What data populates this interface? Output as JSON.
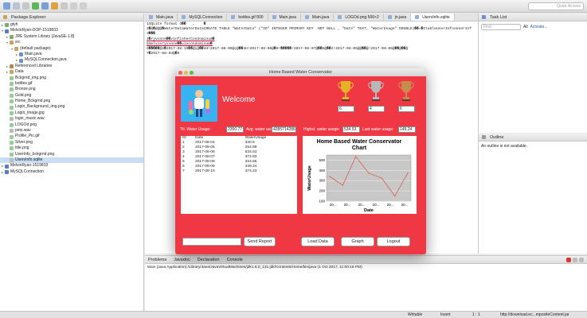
{
  "toolbar": {
    "quick_access": "Quick Access"
  },
  "package_explorer": {
    "title": "Package Explorer",
    "items": [
      {
        "label": "gtyh",
        "indent": 0,
        "twisty": "▸",
        "color": "#7a7"
      },
      {
        "label": "MelvinRyan-DOP-1519833",
        "indent": 0,
        "twisty": "▾",
        "color": "#5a7cc6"
      },
      {
        "label": "JRE System Library [JavaSE-1.8]",
        "indent": 1,
        "twisty": "▸",
        "color": "#8a6"
      },
      {
        "label": "src",
        "indent": 1,
        "twisty": "▾",
        "color": "#c9a45e"
      },
      {
        "label": "(default package)",
        "indent": 2,
        "twisty": "▾",
        "color": "#c9a45e"
      },
      {
        "label": "Main.java",
        "indent": 3,
        "twisty": "▸",
        "color": "#6b8fd0"
      },
      {
        "label": "MySQLConnection.java",
        "indent": 3,
        "twisty": "▸",
        "color": "#6b8fd0"
      },
      {
        "label": "Referenced Libraries",
        "indent": 1,
        "twisty": "▸",
        "color": "#b08850"
      },
      {
        "label": "Data",
        "indent": 1,
        "twisty": "▸",
        "color": "#c9a45e"
      },
      {
        "label": "Bckgrnd_img.png",
        "indent": 1,
        "twisty": "",
        "color": "#9c9"
      },
      {
        "label": "bottles.gif",
        "indent": 1,
        "twisty": "",
        "color": "#9c9"
      },
      {
        "label": "Bronze.png",
        "indent": 1,
        "twisty": "",
        "color": "#9c9"
      },
      {
        "label": "Gold.png",
        "indent": 1,
        "twisty": "",
        "color": "#9c9"
      },
      {
        "label": "Home_Bckgrnd.png",
        "indent": 1,
        "twisty": "",
        "color": "#9c9"
      },
      {
        "label": "Login_Background_img.png",
        "indent": 1,
        "twisty": "",
        "color": "#9c9"
      },
      {
        "label": "Login_image.jpg",
        "indent": 1,
        "twisty": "",
        "color": "#9c9"
      },
      {
        "label": "login_music.wav",
        "indent": 1,
        "twisty": "",
        "color": "#bbb"
      },
      {
        "label": "LOGOd.png",
        "indent": 1,
        "twisty": "",
        "color": "#9c9"
      },
      {
        "label": "pets.wav",
        "indent": 1,
        "twisty": "",
        "color": "#bbb"
      },
      {
        "label": "Profile_Pic.gif",
        "indent": 1,
        "twisty": "",
        "color": "#9c9"
      },
      {
        "label": "Silver.png",
        "indent": 1,
        "twisty": "",
        "color": "#9c9"
      },
      {
        "label": "title.png",
        "indent": 1,
        "twisty": "",
        "color": "#9c9"
      },
      {
        "label": "UserInfo_bckgrnd.png",
        "indent": 1,
        "twisty": "",
        "color": "#9c9"
      },
      {
        "label": "UsersInfo.sqlite",
        "indent": 1,
        "twisty": "",
        "color": "#bbb",
        "selected": true
      },
      {
        "label": "MelvinRyan-1519833",
        "indent": 0,
        "twisty": "▸",
        "color": "#5a7cc6"
      },
      {
        "label": "MySQLConnection",
        "indent": 0,
        "twisty": "▸",
        "color": "#5a7cc6"
      }
    ]
  },
  "editor_tabs": [
    {
      "label": "Main.java",
      "active": false
    },
    {
      "label": "MySQLConnection",
      "active": false
    },
    {
      "label": "bottles.gif 800",
      "active": false
    },
    {
      "label": "Main.java",
      "active": false
    },
    {
      "label": "Main.java",
      "active": false
    },
    {
      "label": "LOGOd.png 506×2",
      "active": false
    },
    {
      "label": "jn.java",
      "active": false
    },
    {
      "label": "UsersInfo.sqlite",
      "active": true
    }
  ],
  "editor_lines": [
    "1SQLite format 3��   ,    �",
    "2�@�@@@�WaterDataWaterDataCREATE TABLE \"WaterData\" (\"ID\" INTEGER PRIMARY KEY  NOT NULL , \"Date\" TEXT, \"WaterUsage\" DOUBLE)��=�ItableUserInfosUserInf",
    "3���",
    "4�ryvonne��vinfisherCondominum�",
    "5melvinryvonne��vincondominum�",
    "6�����@2�2017-08-10��@ç@��4H!2017-08-09@ç@��4H!2017-08-08@�H!�����!2017-08-07@��G@��2!2017-08-05@@��@!2017-08-06@��@��@",
    "7�2017-08-04@�H"
  ],
  "task_list": {
    "title": "Task List",
    "find_placeholder": "Find",
    "all_label": "All",
    "activate_label": "Activate..."
  },
  "outline": {
    "title": "Outline",
    "message": "An outline is not available."
  },
  "console": {
    "tabs": [
      "Problems",
      "Javadoc",
      "Declaration",
      "Console"
    ],
    "line": "Main [Java Application] /Library/Java/JavaVirtualMachines/jdk1.8.0_131.jdk/Contents/Home/bin/java (1 Oct 2017, 11:00:18 PM)"
  },
  "status_bar": {
    "writable": "Writable",
    "insert": "Insert",
    "position": "1 : 1",
    "url": "http://download.ec...mpositeContent.jar"
  },
  "app": {
    "window_title": "Home Based Water Conservator",
    "welcome": "Welcome",
    "trophies": [
      {
        "name": "gold",
        "value": "6",
        "color": "#e6b22a"
      },
      {
        "name": "silver",
        "value": "4",
        "color": "#b8b8b8"
      },
      {
        "name": "bronze",
        "value": "6",
        "color": "#c98a4e"
      }
    ],
    "stats": {
      "total_label": "Ttl. Water Usage:",
      "total_value": "2350.77",
      "avg_label": "Avg. water usage:",
      "avg_value": "4285714286",
      "highest_label": "Highst. water usage:",
      "highest_value": "534.53",
      "last_label": "Last water usage:",
      "last_value": "149.24"
    },
    "table": {
      "headers": [
        "ID",
        "Date",
        "WaterUsage"
      ],
      "rows": [
        [
          "1",
          "2017-08-04",
          "340.5"
        ],
        [
          "2",
          "2017-08-05",
          "254.89"
        ],
        [
          "3",
          "2017-08-06",
          "534.53"
        ],
        [
          "4",
          "2017-08-07",
          "372.83"
        ],
        [
          "5",
          "2017-08-08",
          "324.55"
        ],
        [
          "6",
          "2017-08-09",
          "349.24"
        ],
        [
          "7",
          "2017-08-10",
          "374.23"
        ]
      ]
    },
    "buttons": {
      "send_report": "Send Report",
      "load_data": "Load Data",
      "graph": "Graph",
      "logout": "Logout"
    },
    "report_input_value": ""
  },
  "chart_data": {
    "type": "line",
    "title": "Home Based Water Conservator Chart",
    "xlabel": "Date",
    "ylabel": "WaterUsage",
    "x_tick_labels": [
      "20...",
      "20...",
      "20...",
      "20...",
      "20...",
      "20..."
    ],
    "values": [
      340.5,
      254.89,
      534.53,
      372.83,
      324.55,
      149.24,
      374.23
    ],
    "ylim": [
      100,
      550
    ],
    "y_ticks": [
      100,
      200,
      300,
      400,
      500
    ],
    "line_color": "#e05555",
    "plot_bg": "#c8c8c8",
    "grid": true
  }
}
